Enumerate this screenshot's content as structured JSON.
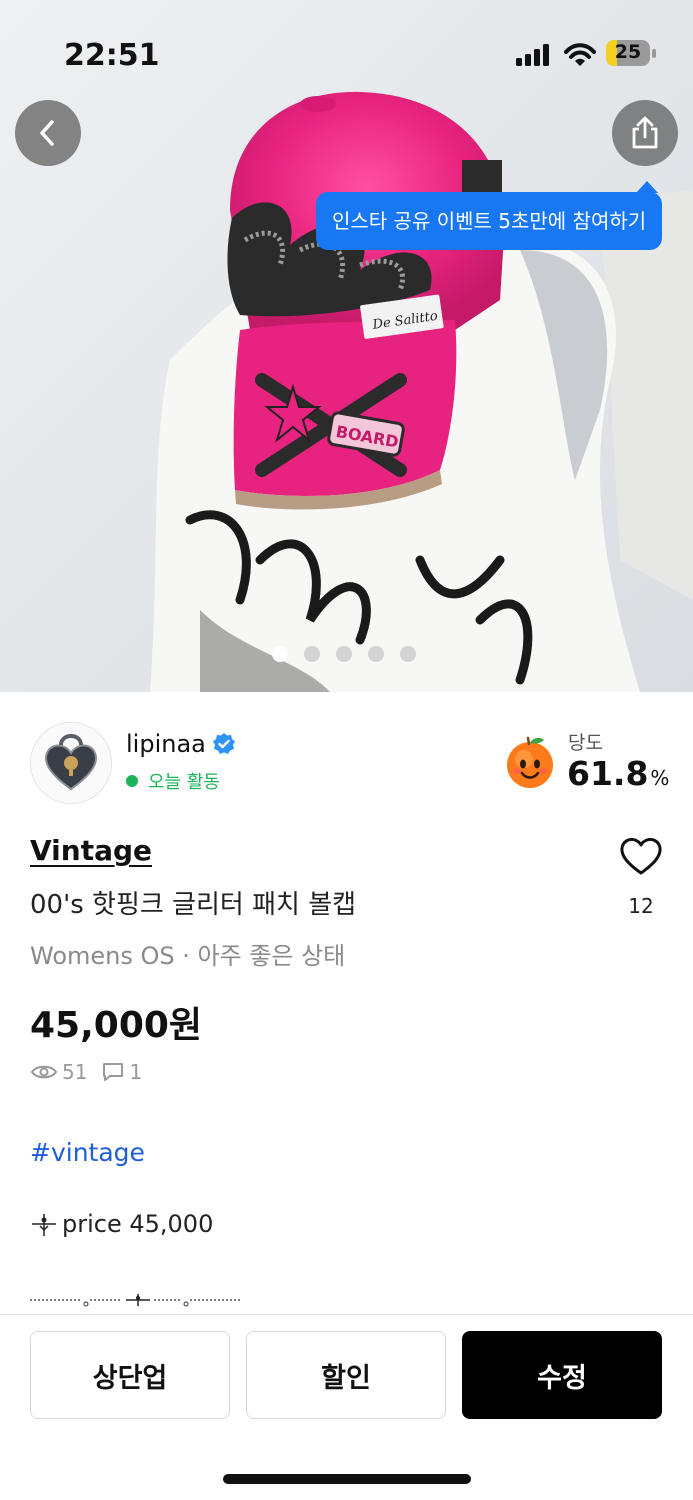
{
  "status_bar": {
    "time": "22:51",
    "battery": "25",
    "battery_level_percent": 25
  },
  "hero": {
    "tooltip": "인스타 공유 이벤트 5초만에 참여하기",
    "page_indicator": {
      "total": 5,
      "active_index": 0
    },
    "icons": {
      "back": "chevron-left-icon",
      "share": "share-icon"
    }
  },
  "seller": {
    "name": "lipinaa",
    "verified": true,
    "activity": "오늘 활동",
    "sweetness_label": "당도",
    "sweetness_value": "61.8",
    "sweetness_unit": "%"
  },
  "product": {
    "brand": "Vintage",
    "title": "00's 핫핑크 글리터 패치 볼캡",
    "meta": "Womens OS · 아주 좋은 상태",
    "price": "45,000원",
    "views": "51",
    "comments": "1",
    "likes": "12",
    "hashtag": "#vintage",
    "description": "price 45,000"
  },
  "actions": {
    "bump": "상단업",
    "discount": "할인",
    "edit": "수정"
  },
  "colors": {
    "accent_blue": "#1877f2",
    "active_green": "#1bb45a",
    "primary_button": "#000000"
  }
}
